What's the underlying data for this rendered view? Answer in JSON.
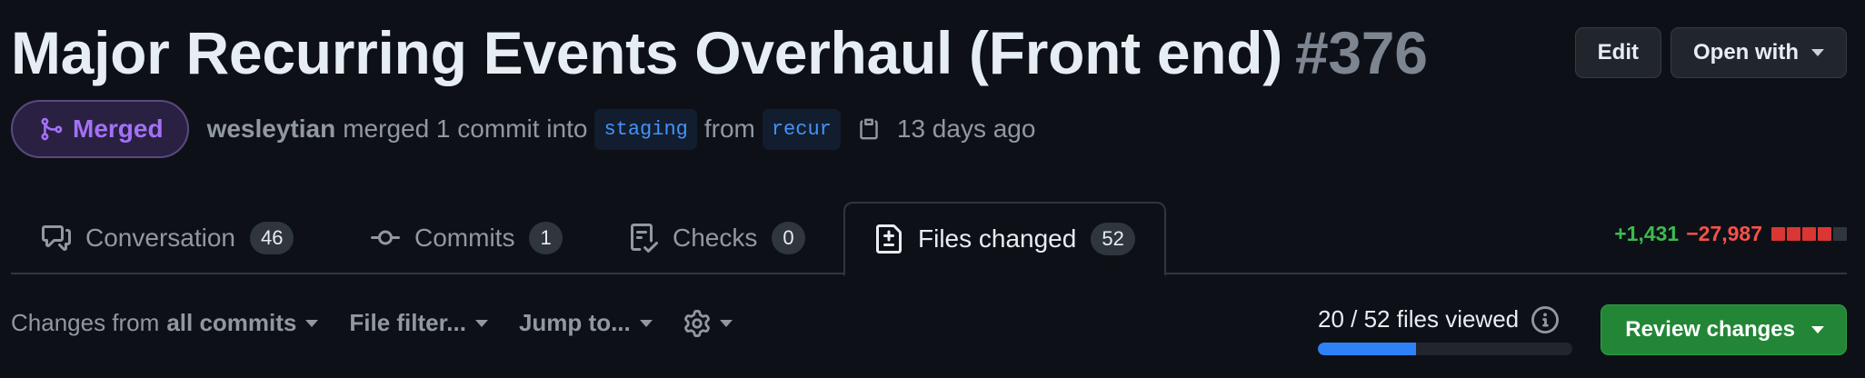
{
  "header": {
    "title": "Major Recurring Events Overhaul (Front end)",
    "number": "#376",
    "edit_label": "Edit",
    "open_with_label": "Open with"
  },
  "meta": {
    "status": "Merged",
    "author": "wesleytian",
    "action_text": "merged 1 commit into",
    "base_branch": "staging",
    "from_text": "from",
    "head_branch": "recur",
    "time_ago": "13 days ago"
  },
  "tabs": [
    {
      "label": "Conversation",
      "count": "46",
      "icon": "comment-discussion-icon"
    },
    {
      "label": "Commits",
      "count": "1",
      "icon": "git-commit-icon"
    },
    {
      "label": "Checks",
      "count": "0",
      "icon": "checklist-icon"
    },
    {
      "label": "Files changed",
      "count": "52",
      "icon": "file-diff-icon",
      "active": true
    }
  ],
  "diffstat": {
    "additions": "+1,431",
    "deletions": "−27,987",
    "blocks": [
      "#da3633",
      "#da3633",
      "#da3633",
      "#da3633",
      "#30363d"
    ]
  },
  "toolbar": {
    "changes_prefix": "Changes from",
    "changes_value": "all commits",
    "file_filter": "File filter...",
    "jump_to": "Jump to..."
  },
  "viewed": {
    "label": "20 / 52 files viewed",
    "viewed": 20,
    "total": 52
  },
  "review_button": "Review changes",
  "colors": {
    "background": "#0d1117",
    "merged_purple": "#a371f7",
    "addition_green": "#3fb950",
    "deletion_red": "#f85149",
    "progress_blue": "#2f81f7",
    "review_green": "#238636"
  }
}
